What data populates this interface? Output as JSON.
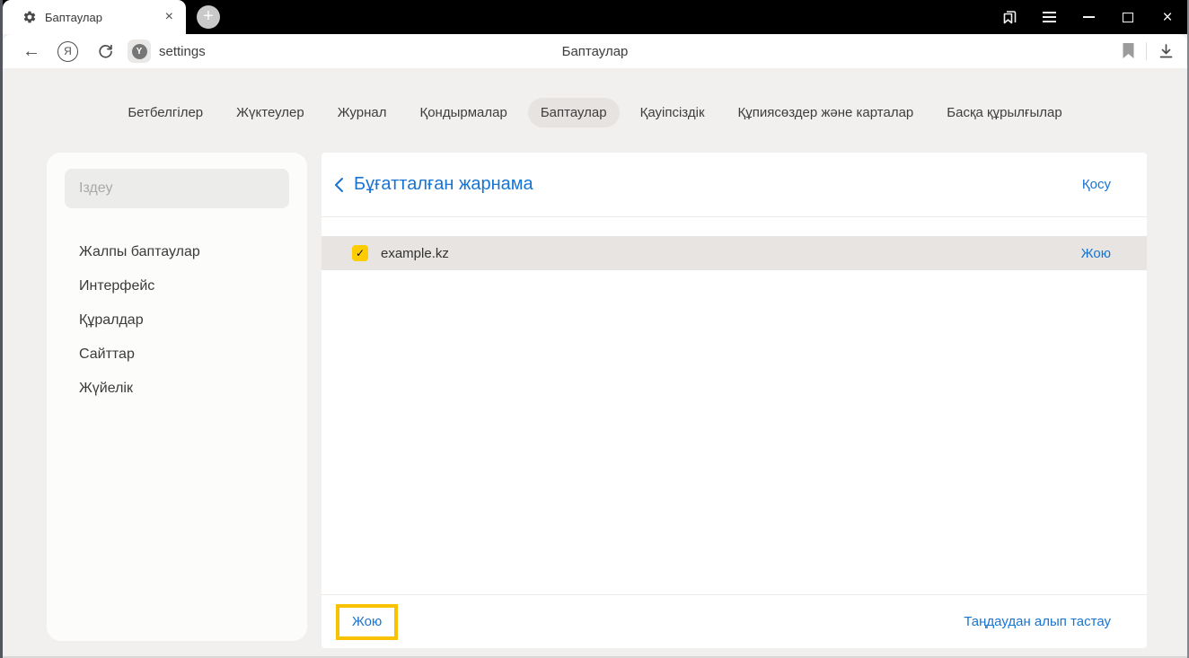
{
  "icons": {
    "back": "←",
    "close": "×",
    "plus": "+",
    "yandex_logo": "Я",
    "protect_letter": "Y",
    "check": "✓"
  },
  "tab_bar": {
    "active_tab_title": "Баптаулар"
  },
  "toolbar": {
    "url": "settings",
    "page_title": "Баптаулар"
  },
  "nav_tabs": {
    "items": [
      {
        "label": "Бетбелгілер",
        "active": false
      },
      {
        "label": "Жүктеулер",
        "active": false
      },
      {
        "label": "Журнал",
        "active": false
      },
      {
        "label": "Қондырмалар",
        "active": false
      },
      {
        "label": "Баптаулар",
        "active": true
      },
      {
        "label": "Қауіпсіздік",
        "active": false
      },
      {
        "label": "Құпиясөздер және карталар",
        "active": false
      },
      {
        "label": "Басқа құрылғылар",
        "active": false
      }
    ]
  },
  "sidebar": {
    "search_placeholder": "Іздеу",
    "items": [
      {
        "label": "Жалпы баптаулар"
      },
      {
        "label": "Интерфейс"
      },
      {
        "label": "Құралдар"
      },
      {
        "label": "Сайттар"
      },
      {
        "label": "Жүйелік"
      }
    ]
  },
  "content": {
    "title": "Бұғатталған жарнама",
    "add_label": "Қосу",
    "rows": [
      {
        "domain": "example.kz",
        "checked": true,
        "delete_label": "Жою"
      }
    ],
    "footer": {
      "delete_label": "Жою",
      "deselect_label": "Таңдаудан алып тастау"
    }
  },
  "colors": {
    "accent_blue": "#1774d2",
    "yandex_yellow": "#ffcc00",
    "highlight_border": "#f8c200",
    "row_background": "#e7e4e1",
    "page_background": "#f1f0ee"
  }
}
